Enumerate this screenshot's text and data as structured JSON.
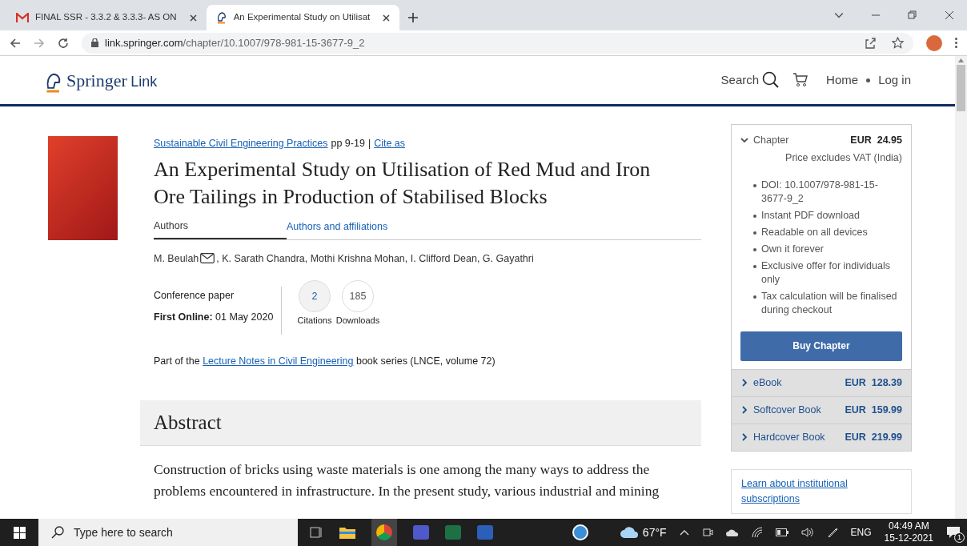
{
  "browser": {
    "tabs": [
      {
        "kind": "gmail",
        "title": "FINAL SSR - 3.3.2 & 3.3.3- AS ON",
        "selected": false
      },
      {
        "kind": "springer",
        "title": "An Experimental Study on Utilisat",
        "selected": true
      }
    ],
    "url": {
      "host": "link.springer.com",
      "path": "/chapter/10.1007/978-981-15-3677-9_2"
    }
  },
  "header": {
    "brand": "Springer",
    "brand_sub": "Link",
    "search": "Search",
    "home": "Home",
    "login": "Log in"
  },
  "article": {
    "book": "Sustainable Civil Engineering Practices",
    "pages": "pp 9-19",
    "separator": "|",
    "cite": "Cite as",
    "title": "An Experimental Study on Utilisation of Red Mud and Iron Ore Tailings in Production of Stabilised Blocks",
    "author_tabs": [
      {
        "label": "Authors",
        "selected": true
      },
      {
        "label": "Authors and affiliations",
        "selected": false
      }
    ],
    "authors": [
      {
        "name": "M. Beulah",
        "email": true
      },
      {
        "name": ", K. Sarath Chandra, Mothi Krishna Mohan, I. Clifford Dean, G. Gayathri",
        "email": false
      }
    ],
    "type": "Conference paper",
    "first_online_label": "First Online:",
    "first_online": "01 May 2020",
    "metrics": [
      {
        "value": "2",
        "label": "Citations",
        "link": true
      },
      {
        "value": "185",
        "label": "Downloads",
        "link": false
      }
    ],
    "series_prefix": "Part of the",
    "series_link": "Lecture Notes in Civil Engineering",
    "series_suffix": "book series (LNCE, volume 72)",
    "abstract_heading": "Abstract",
    "abstract": "Construction of bricks using waste materials is one among the many ways to address the problems encountered in infrastructure. In the present study, various industrial and mining"
  },
  "sidebar": {
    "chapter": {
      "label": "Chapter",
      "expanded": true,
      "currency": "EUR",
      "price": "24.95",
      "note": "Price excludes VAT (India)",
      "features": [
        "DOI: 10.1007/978-981-15-3677-9_2",
        "Instant PDF download",
        "Readable on all devices",
        "Own it forever",
        "Exclusive offer for individuals only",
        "Tax calculation will be finalised during checkout"
      ],
      "button": "Buy Chapter"
    },
    "options": [
      {
        "label": "eBook",
        "currency": "EUR",
        "price": "128.39",
        "expanded": false
      },
      {
        "label": "Softcover Book",
        "currency": "EUR",
        "price": "159.99",
        "expanded": false
      },
      {
        "label": "Hardcover Book",
        "currency": "EUR",
        "price": "219.99",
        "expanded": false
      }
    ],
    "subscriptions": "Learn about institutional subscriptions"
  },
  "taskbar": {
    "search_placeholder": "Type here to search",
    "weather": "67°F",
    "language": "ENG",
    "time": "04:49 AM",
    "date": "15-12-2021",
    "notifications": "1"
  }
}
